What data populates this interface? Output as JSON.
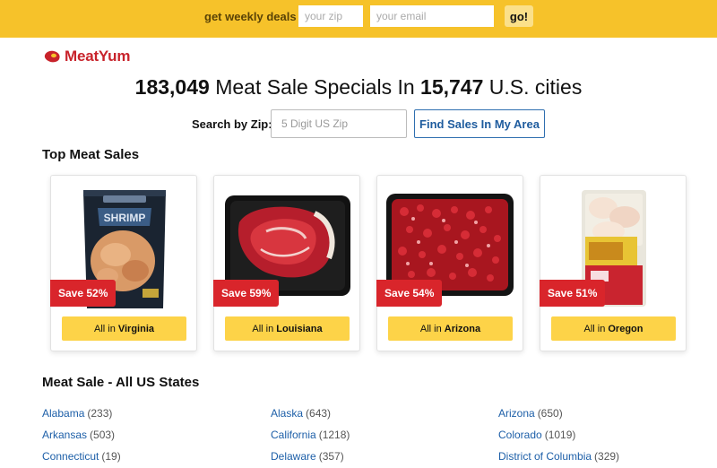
{
  "deals_bar": {
    "label": "get weekly deals",
    "zip_placeholder": "your zip",
    "email_placeholder": "your email",
    "go_label": "go!",
    "color": "#f6c22a"
  },
  "brand": {
    "name": "MeatYum",
    "color": "#c8232b",
    "icon": "meat-steak-icon"
  },
  "headline": {
    "count": "183,049",
    "middle": "Meat Sale Specials In",
    "cities_count": "15,747",
    "end": "U.S. cities"
  },
  "search": {
    "label": "Search by Zip:",
    "placeholder": "5 Digit US Zip",
    "button_label": "Find Sales In My Area"
  },
  "top_sales": {
    "title": "Top Meat Sales",
    "cards": [
      {
        "image": "shrimp-bag",
        "save": "Save 52%",
        "prefix": "All in",
        "state": "Virginia"
      },
      {
        "image": "ribeye-steak-tray",
        "save": "Save 59%",
        "prefix": "All in",
        "state": "Louisiana"
      },
      {
        "image": "ground-beef-tray",
        "save": "Save 54%",
        "prefix": "All in",
        "state": "Arizona"
      },
      {
        "image": "chicken-leg-quarters-pack",
        "save": "Save 51%",
        "prefix": "All in",
        "state": "Oregon"
      }
    ],
    "badge_color": "#d9252b",
    "button_color": "#fdd348"
  },
  "states_section": {
    "title": "Meat Sale - All US States",
    "states": [
      {
        "name": "Alabama",
        "count": "(233)"
      },
      {
        "name": "Alaska",
        "count": "(643)"
      },
      {
        "name": "Arizona",
        "count": "(650)"
      },
      {
        "name": "Arkansas",
        "count": "(503)"
      },
      {
        "name": "California",
        "count": "(1218)"
      },
      {
        "name": "Colorado",
        "count": "(1019)"
      },
      {
        "name": "Connecticut",
        "count": "(19)"
      },
      {
        "name": "Delaware",
        "count": "(357)"
      },
      {
        "name": "District of Columbia",
        "count": "(329)"
      }
    ],
    "link_color": "#1d5fa8"
  }
}
